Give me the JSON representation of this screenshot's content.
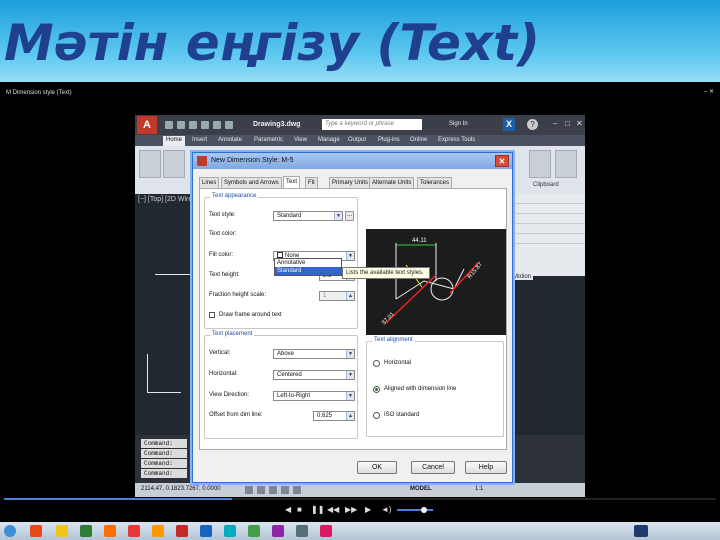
{
  "slide": {
    "title": "Мәтін еңгізу (Text)"
  },
  "player": {
    "doc_title": "M Dimension style (Text)",
    "window_controls": "–  ✕",
    "time": "",
    "progress": 0.32,
    "volume": 0.75
  },
  "autocad": {
    "file_name": "Drawing3.dwg",
    "search_placeholder": "Type a keyword or phrase",
    "sign_in": "Sign In",
    "tabs": [
      "Home",
      "Insert",
      "Annotate",
      "Parametric",
      "View",
      "Manage",
      "Output",
      "Plug-ins",
      "Online",
      "Express Tools"
    ],
    "viewport_label": "[−] [Top] [2D Wireframe]",
    "command_lines": [
      "Command:",
      "Command:",
      "Command:",
      "Command:"
    ],
    "clipboard_label": "Clipboard",
    "motion_label": "Motion",
    "coords": "2114.47, 0.1823.7267, 0.0000",
    "model_label": "MODEL",
    "scale_label": "1:1"
  },
  "dialog": {
    "title": "New Dimension Style: M-5",
    "tabs": [
      "Lines",
      "Symbols and Arrows",
      "Text",
      "Fit",
      "Primary Units",
      "Alternate Units",
      "Tolerances"
    ],
    "text_appearance": {
      "legend": "Text appearance",
      "style_label": "Text style:",
      "style_value": "Standard",
      "color_label": "Text color:",
      "fill_label": "Fill color:",
      "fill_value": "None",
      "height_label": "Text height:",
      "height_value": "2.5",
      "fraction_label": "Fraction height scale:",
      "fraction_value": "1",
      "frame_label": "Draw frame around text"
    },
    "style_options": [
      "Annotative",
      "Standard"
    ],
    "tooltip": "Lists the available text styles.",
    "text_placement": {
      "legend": "Text placement",
      "vertical_label": "Vertical:",
      "vertical_value": "Above",
      "horizontal_label": "Horizontal:",
      "horizontal_value": "Centered",
      "view_label": "View Direction:",
      "view_value": "Left-to-Right",
      "offset_label": "Offset from dim line:",
      "offset_value": "0.625"
    },
    "text_alignment": {
      "legend": "Text alignment",
      "options": [
        "Horizontal",
        "Aligned with dimension line",
        "ISO standard"
      ],
      "selected": 1
    },
    "preview": {
      "dim1": "44.11",
      "dim2": "R15.87",
      "dim3": "37.01"
    },
    "buttons": {
      "ok": "OK",
      "cancel": "Cancel",
      "help": "Help"
    }
  }
}
